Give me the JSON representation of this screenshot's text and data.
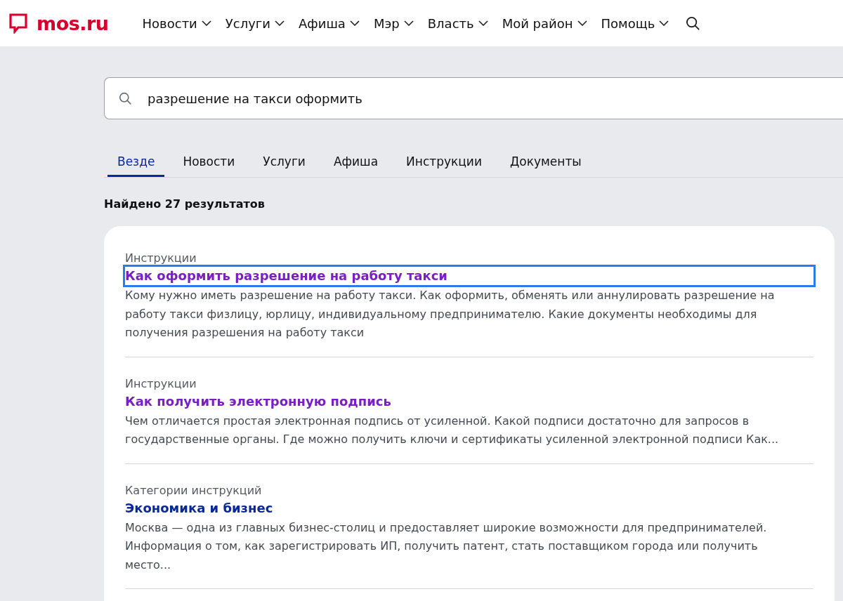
{
  "header": {
    "logo": "mos.ru",
    "nav": [
      {
        "label": "Новости"
      },
      {
        "label": "Услуги"
      },
      {
        "label": "Афиша"
      },
      {
        "label": "Мэр"
      },
      {
        "label": "Власть"
      },
      {
        "label": "Мой район"
      },
      {
        "label": "Помощь"
      }
    ]
  },
  "search": {
    "value": "разрешение на такси оформить"
  },
  "tabs": [
    {
      "label": "Везде",
      "selected": true
    },
    {
      "label": "Новости",
      "selected": false
    },
    {
      "label": "Услуги",
      "selected": false
    },
    {
      "label": "Афиша",
      "selected": false
    },
    {
      "label": "Инструкции",
      "selected": false
    },
    {
      "label": "Документы",
      "selected": false
    }
  ],
  "results_count": "Найдено 27 результатов",
  "results": [
    {
      "category": "Инструкции",
      "title": "Как оформить разрешение на работу такси",
      "visited": true,
      "focused": true,
      "snippet": "Кому нужно иметь разрешение на работу такси. Как оформить, обменять или аннулировать разрешение на работу такси физлицу, юрлицу, индивидуальному предпринимателю. Какие документы необходимы для получения разрешения на работу такси"
    },
    {
      "category": "Инструкции",
      "title": "Как получить электронную подпись",
      "visited": true,
      "focused": false,
      "snippet": "Чем отличается простая электронная подпись от усиленной. Какой подписи достаточно для запросов в государственные органы. Где можно получить ключи и сертификаты усиленной электронной подписи Как..."
    },
    {
      "category": "Категории инструкций",
      "title": "Экономика и бизнес",
      "visited": false,
      "focused": false,
      "snippet": "Москва — одна из главных бизнес-столиц и предоставляет широкие возможности для предпринимателей. Информация о том, как зарегистрировать ИП, получить патент, стать поставщиком города или получить место..."
    }
  ]
}
